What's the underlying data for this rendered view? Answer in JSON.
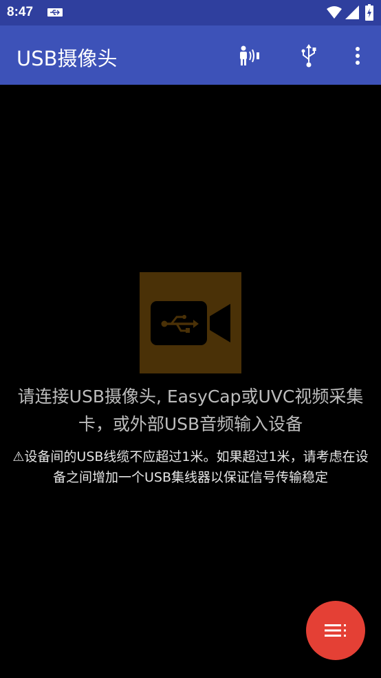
{
  "status_bar": {
    "time": "8:47",
    "icons": [
      "usb-icon",
      "wifi-icon",
      "cell-signal-icon",
      "battery-charging-icon"
    ]
  },
  "app_bar": {
    "title": "USB摄像头",
    "actions": [
      "audio-speaker-icon",
      "usb-icon",
      "more-vert-icon"
    ]
  },
  "content": {
    "placeholder_icon": "usb-camera-icon",
    "message": "请连接USB摄像头, EasyCap或UVC视频采集卡，或外部USB音频输入设备",
    "warning": "⚠设备间的USB线缆不应超过1米。如果超过1米，请考虑在设备之间增加一个USB集线器以保证信号传输稳定"
  },
  "fab": {
    "icon": "menu-list-icon"
  },
  "colors": {
    "status_bar": "#2f3f9e",
    "app_bar": "#3d52b8",
    "background": "#000000",
    "camera_box": "#4a3107",
    "fab": "#e44035"
  }
}
